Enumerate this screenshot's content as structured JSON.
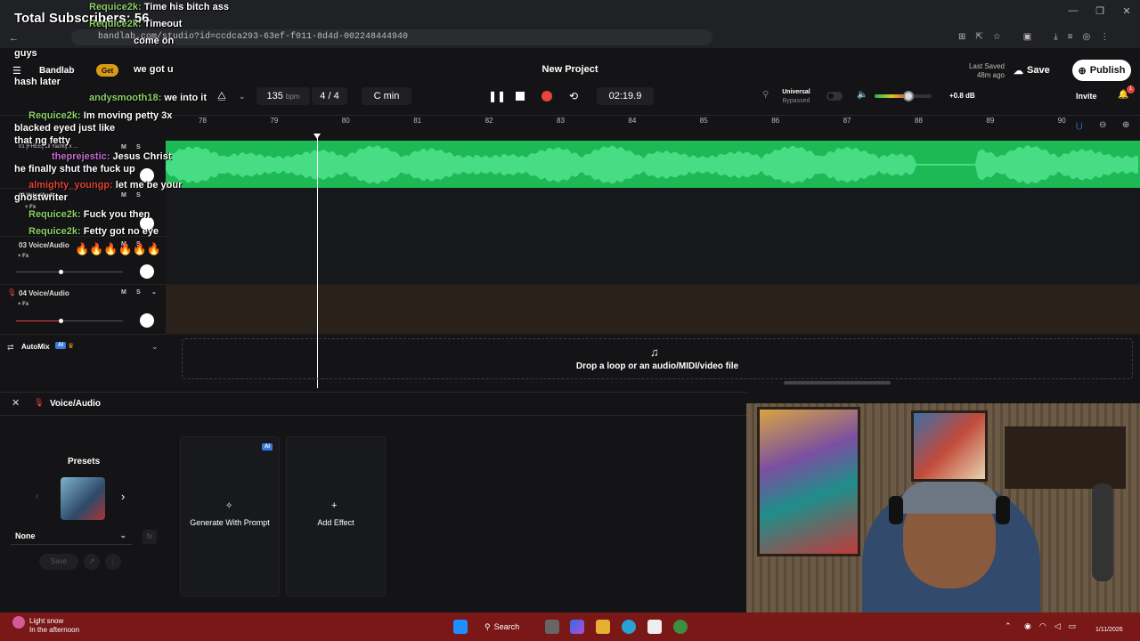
{
  "overlay": {
    "subscribers": "Total Subscribers: 56",
    "chat": [
      {
        "name": "Requice2k:",
        "message": "Time his bitch ass"
      },
      {
        "name": "Requice2k:",
        "message": "Timeout"
      },
      {
        "name": "",
        "message": "come on"
      },
      {
        "name": "",
        "message": "guys"
      },
      {
        "name": "",
        "message": "we got u"
      },
      {
        "name": "",
        "message": "hash later"
      },
      {
        "name": "andysmooth18:",
        "message": "we into it"
      },
      {
        "name": "Requice2k:",
        "message": "Im moving petty 3x"
      },
      {
        "name": "",
        "message": "blacked eyed just like"
      },
      {
        "name": "",
        "message": "that ng fetty"
      },
      {
        "name": "theprejestic:",
        "message": "Jesus Christ"
      },
      {
        "name": "",
        "message": "he finally shut the fuck up"
      },
      {
        "name": "almighty_youngp:",
        "message": "let me be your"
      },
      {
        "name": "",
        "message": "ghostwriter"
      },
      {
        "name": "Requice2k:",
        "message": "Fuck you then"
      },
      {
        "name": "Requice2k:",
        "message": "Fetty got no eye"
      }
    ],
    "fire_emojis": "🔥🔥🔥🔥🔥🔥"
  },
  "browser": {
    "url": "bandlab.com/studio?id=ccdca293-63ef-f011-8d4d-002248444940",
    "app_label": "Bandlab",
    "get_label": "Get"
  },
  "header": {
    "project_title": "New Project",
    "last_saved_label": "Last Saved",
    "last_saved_time": "48m ago",
    "save_label": "Save",
    "publish_label": "Publish",
    "invite_label": "Invite",
    "notification_count": "1"
  },
  "transport": {
    "bpm": "135",
    "bpm_unit": "bpm",
    "time_sig": "4 / 4",
    "key": "C min",
    "time": "02:19.9",
    "preset_name": "Universal",
    "preset_state": "Bypassed",
    "master_db": "+0.8 dB",
    "master_level": 0.6
  },
  "ruler": [
    "78",
    "79",
    "80",
    "81",
    "82",
    "83",
    "84",
    "85",
    "86",
    "87",
    "88",
    "89",
    "90"
  ],
  "tracks": [
    {
      "num": "01",
      "name": "[FREE] Lil Yachty x ...",
      "m": "M",
      "s": "S",
      "fx": "+ Fx"
    },
    {
      "num": "02",
      "name": "Voice/Audio",
      "m": "M",
      "s": "S",
      "fx": "+ Fx"
    },
    {
      "num": "03",
      "name": "Voice/Audio",
      "m": "M",
      "s": "S",
      "fx": "+ Fx"
    },
    {
      "num": "04",
      "name": "Voice/Audio",
      "m": "M",
      "s": "S",
      "fx": "+ Fx"
    }
  ],
  "automix": {
    "label": "AutoMix",
    "badge": "AI"
  },
  "drop_zone": "Drop a loop or an audio/MIDI/video file",
  "effects": {
    "track_name": "Voice/Audio",
    "presets_label": "Presets",
    "preset_value": "None",
    "save_label": "Save",
    "generate_label": "Generate With Prompt",
    "generate_badge": "AI",
    "add_effect_label": "Add Effect"
  },
  "taskbar": {
    "weather_title": "Light snow",
    "weather_sub": "In the afternoon",
    "search_label": "Search",
    "date": "1/11/2026"
  },
  "colors": {
    "waveform": "#1db954",
    "record": "#e8453c",
    "taskbar": "#7a1717",
    "accent": "#3b7be0"
  }
}
